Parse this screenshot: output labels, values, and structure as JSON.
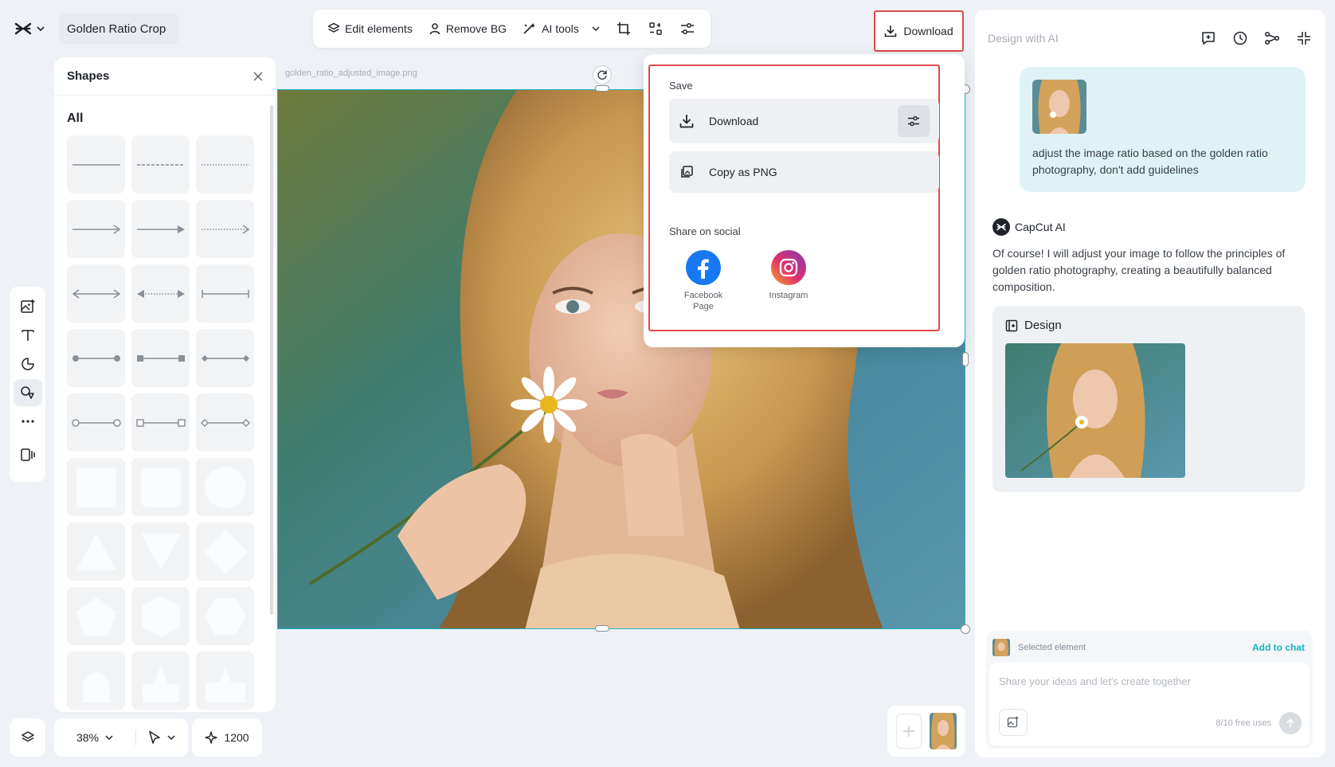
{
  "app": {
    "project_title": "Golden Ratio Crop"
  },
  "toolbar": {
    "edit_elements": "Edit elements",
    "remove_bg": "Remove BG",
    "ai_tools": "AI tools"
  },
  "download_button": {
    "label": "Download"
  },
  "shapes_panel": {
    "title": "Shapes",
    "section_all": "All",
    "items": [
      "solid-line",
      "dashed-line",
      "dotted-line",
      "arrow-line",
      "arrow-filled-line",
      "dotted-arrow-line",
      "double-arrow-line",
      "dotted-double-arrow-line",
      "bar-ended-line",
      "dot-ended-line",
      "square-ended-line",
      "diamond-ended-line",
      "circle-outline-ended-line",
      "square-outline-ended-line",
      "diamond-outline-ended-line",
      "square",
      "rounded-square",
      "circle",
      "triangle",
      "inverted-triangle",
      "diamond",
      "pentagon",
      "hexagon",
      "hexagon-flat",
      "shape-partial-1",
      "shape-partial-2",
      "shape-partial-3"
    ]
  },
  "canvas": {
    "filename": "golden_ratio_adjusted_image.png"
  },
  "download_popover": {
    "save_label": "Save",
    "download_label": "Download",
    "copy_png_label": "Copy as PNG",
    "share_label": "Share on social",
    "facebook_label_line1": "Facebook",
    "facebook_label_line2": "Page",
    "instagram_label": "Instagram"
  },
  "right_panel": {
    "title": "Design with AI",
    "user_message": "adjust the image ratio based on the golden ratio photography, don't add guidelines",
    "ai_name": "CapCut AI",
    "ai_message": "Of course! I will adjust your image to follow the principles of golden ratio photography, creating a beautifully balanced composition.",
    "design_label": "Design",
    "selected_element": "Selected element",
    "add_to_chat": "Add to chat",
    "input_placeholder": "Share your ideas and let's create together",
    "free_uses": "8/10 free uses"
  },
  "bottom_bar": {
    "zoom": "38%",
    "credits": "1200"
  },
  "colors": {
    "accent": "#20b6cc",
    "highlight_border": "#e04848",
    "facebook": "#1877f2",
    "background": "#eef1f5"
  }
}
